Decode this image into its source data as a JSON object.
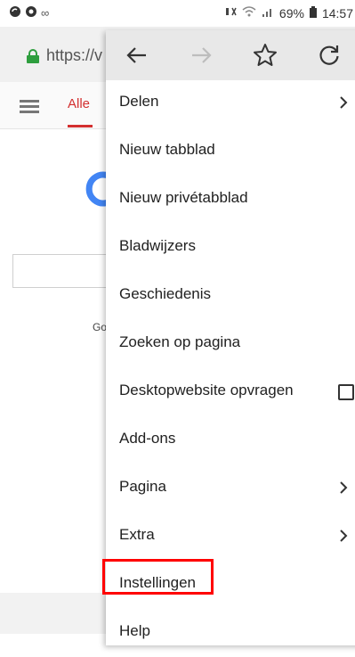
{
  "status_bar": {
    "left_icons": [
      "sync-icon",
      "chrome-icon",
      "voicemail-icon"
    ],
    "battery": "69%",
    "time": "14:57"
  },
  "browser": {
    "url": "https://v"
  },
  "page": {
    "tab_label": "Alle",
    "partial_text": "Go"
  },
  "menu": {
    "toolbar": [
      "back-icon",
      "forward-icon",
      "bookmark-star-icon",
      "reload-icon"
    ],
    "items": [
      {
        "label": "Delen",
        "control": "chevron"
      },
      {
        "label": "Nieuw tabblad",
        "control": "none"
      },
      {
        "label": "Nieuw privétabblad",
        "control": "none"
      },
      {
        "label": "Bladwijzers",
        "control": "none"
      },
      {
        "label": "Geschiedenis",
        "control": "none"
      },
      {
        "label": "Zoeken op pagina",
        "control": "none"
      },
      {
        "label": "Desktopwebsite opvragen",
        "control": "checkbox"
      },
      {
        "label": "Add-ons",
        "control": "none"
      },
      {
        "label": "Pagina",
        "control": "chevron"
      },
      {
        "label": "Extra",
        "control": "chevron"
      },
      {
        "label": "Instellingen",
        "control": "none"
      },
      {
        "label": "Help",
        "control": "none"
      }
    ],
    "highlighted_item": "Instellingen",
    "highlight_color": "#ff0000"
  },
  "colors": {
    "accent_red": "#d32f2f",
    "lock_green": "#2e9e3e",
    "toolbar_bg": "#e8e8e8"
  }
}
